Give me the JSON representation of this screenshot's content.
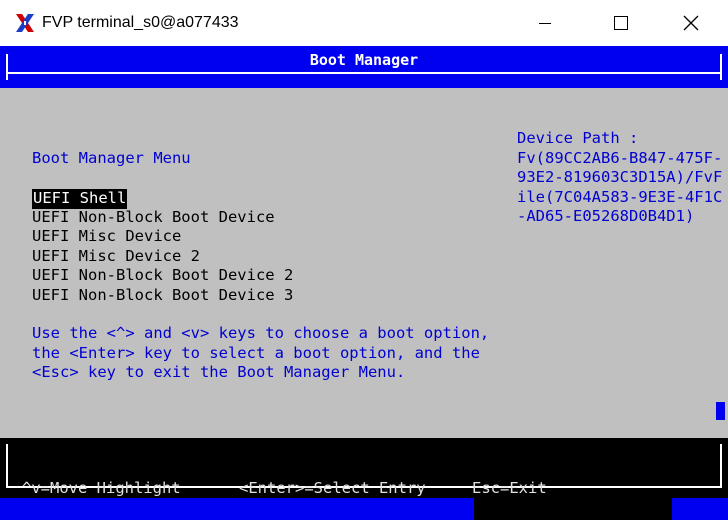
{
  "window": {
    "title": "FVP terminal_s0@a077433",
    "icon": "x-window-icon",
    "controls": [
      "minimize-icon",
      "maximize-icon",
      "close-icon"
    ]
  },
  "header": {
    "title": "Boot Manager"
  },
  "main": {
    "menu_title": "Boot Manager Menu",
    "items": [
      {
        "label": "UEFI Shell",
        "selected": true
      },
      {
        "label": "UEFI Non-Block Boot Device",
        "selected": false
      },
      {
        "label": "UEFI Misc Device",
        "selected": false
      },
      {
        "label": "UEFI Misc Device 2",
        "selected": false
      },
      {
        "label": "UEFI Non-Block Boot Device 2",
        "selected": false
      },
      {
        "label": "UEFI Non-Block Boot Device 3",
        "selected": false
      }
    ],
    "help_lines": [
      "Use the <^> and <v> keys to choose a boot option,",
      "the <Enter> key to select a boot option, and the",
      "<Esc> key to exit the Boot Manager Menu."
    ]
  },
  "device_path": {
    "lines": [
      "Device Path :",
      "Fv(89CC2AB6-B847-475F-",
      "93E2-819603C3D15A)/FvF",
      "ile(7C04A583-9E3E-4F1C",
      "-AD65-E05268D0B4D1)"
    ]
  },
  "footer": {
    "move": "^v=Move Highlight",
    "select": "<Enter>=Select Entry",
    "exit": "Esc=Exit"
  },
  "colors": {
    "terminal_bg": "#c0c0c0",
    "bar_blue": "#0000f0",
    "text_blue": "#0000d0",
    "footer_bg": "#000000"
  }
}
